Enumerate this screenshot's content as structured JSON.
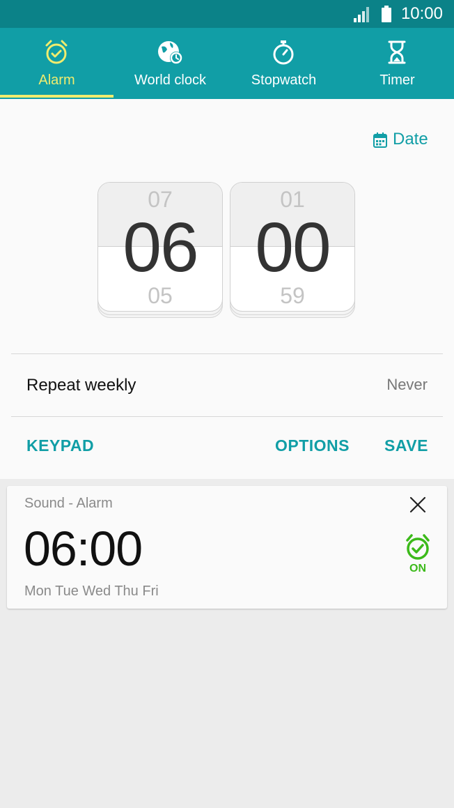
{
  "status_bar": {
    "time": "10:00",
    "signal_icon": "signal-icon",
    "battery_icon": "battery-icon"
  },
  "tabs": [
    {
      "label": "Alarm",
      "icon": "alarm-clock-icon",
      "active": true
    },
    {
      "label": "World clock",
      "icon": "globe-clock-icon",
      "active": false
    },
    {
      "label": "Stopwatch",
      "icon": "stopwatch-icon",
      "active": false
    },
    {
      "label": "Timer",
      "icon": "hourglass-icon",
      "active": false
    }
  ],
  "editor": {
    "date_label": "Date",
    "hour": {
      "prev": "07",
      "current": "06",
      "next": "05"
    },
    "minute": {
      "prev": "01",
      "current": "00",
      "next": "59"
    },
    "repeat_label": "Repeat weekly",
    "repeat_value": "Never",
    "keypad_label": "KEYPAD",
    "options_label": "OPTIONS",
    "save_label": "SAVE"
  },
  "alarm": {
    "title": "Sound - Alarm",
    "time": "06:00",
    "days": "Mon Tue Wed Thu Fri",
    "toggle_label": "ON"
  },
  "colors": {
    "status_bar": "#0b8288",
    "tab_bar": "#119ea6",
    "active_tab": "#f0ec6e",
    "accent": "#119ea6",
    "alarm_on": "#3cba1a"
  }
}
